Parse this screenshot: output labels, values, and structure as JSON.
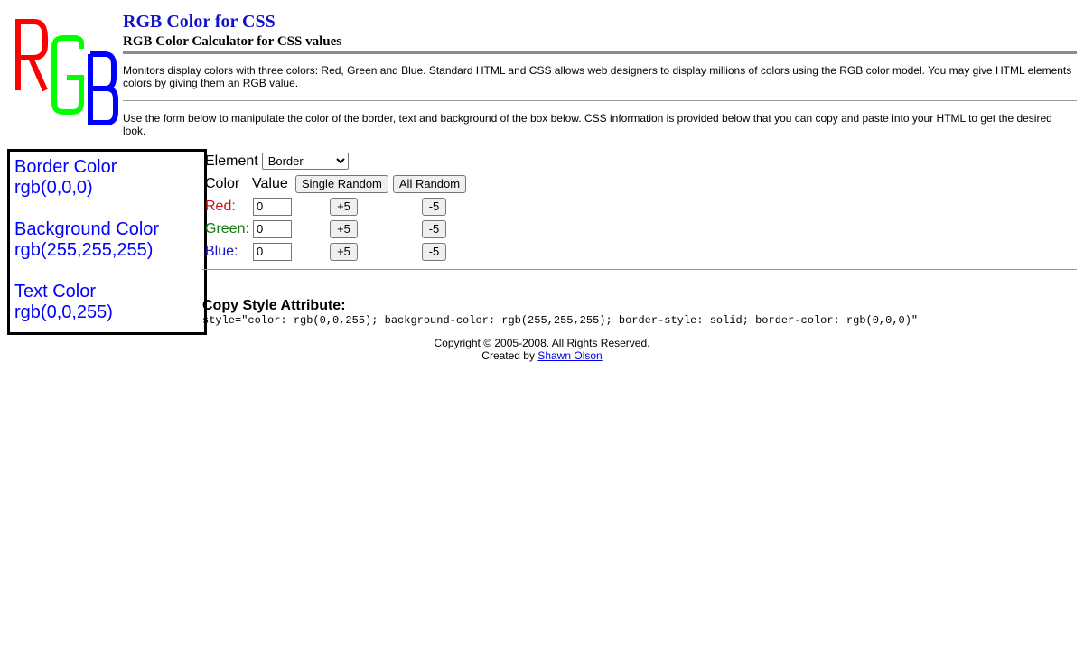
{
  "logo": {
    "letters": [
      "R",
      "G",
      "B"
    ],
    "colors": [
      "#ff0000",
      "#00ff00",
      "#0000ff"
    ]
  },
  "header": {
    "title": "RGB Color for CSS",
    "subtitle": "RGB Color Calculator for CSS values"
  },
  "intro": "Monitors display colors with three colors: Red, Green and Blue. Standard HTML and CSS allows web designers to display millions of colors using the RGB color model. You may give HTML elements colors by giving them an RGB value.",
  "instructions": "Use the form below to manipulate the color of the border, text and background of the box below. CSS information is provided below that you can copy and paste into your HTML to get the desired look.",
  "preview": {
    "border_label": "Border Color",
    "border_value": "rgb(0,0,0)",
    "background_label": "Background Color",
    "background_value": "rgb(255,255,255)",
    "text_label": "Text Color",
    "text_value": "rgb(0,0,255)"
  },
  "controls": {
    "element_label": "Element",
    "element_selected": "Border",
    "color_header": "Color",
    "value_header": "Value",
    "single_random": "Single Random",
    "all_random": "All Random",
    "channels": [
      {
        "label": "Red:",
        "value": "0",
        "plus": "+5",
        "minus": "-5"
      },
      {
        "label": "Green:",
        "value": "0",
        "plus": "+5",
        "minus": "-5"
      },
      {
        "label": "Blue:",
        "value": "0",
        "plus": "+5",
        "minus": "-5"
      }
    ]
  },
  "copy": {
    "title": "Copy Style Attribute:",
    "code": "style=\"color: rgb(0,0,255); background-color: rgb(255,255,255); border-style: solid; border-color: rgb(0,0,0)\""
  },
  "footer": {
    "copyright": "Copyright © 2005-2008. All Rights Reserved.",
    "created_by": "Created by",
    "author_link": "Shawn Olson"
  }
}
